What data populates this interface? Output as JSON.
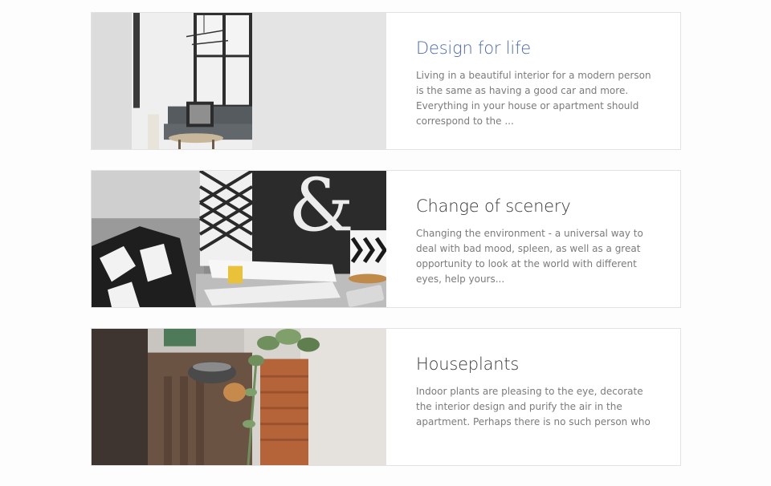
{
  "posts": [
    {
      "title": "Design for life",
      "excerpt": "Living in a beautiful interior for a modern person is the same as having a good car and more. Everything in your house or apartment should correspond to the ...",
      "image": "living-room-image",
      "title_color": "#4d6ab2"
    },
    {
      "title": "Change of scenery",
      "excerpt": "Changing the environment - a universal way to deal with bad mood, spleen, as well as a great opportunity to look at the world with different eyes, help yours...",
      "image": "magazines-ampersand-image",
      "title_color": "#3a3a3a"
    },
    {
      "title": "Houseplants",
      "excerpt": "Indoor plants are pleasing to the eye, decorate the interior design and purify the air in the apartment. Perhaps there is no such person who",
      "image": "houseplants-image",
      "title_color": "#3a3a3a"
    }
  ],
  "colors": {
    "accent": "#4d6ab2",
    "text": "#3a3a3a",
    "muted": "#7b7b7b",
    "border": "#e2e2e2"
  }
}
